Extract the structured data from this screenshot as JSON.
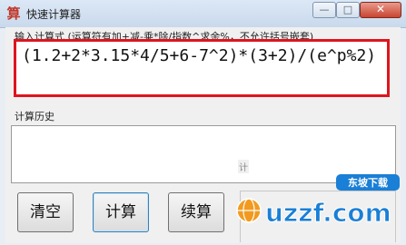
{
  "window": {
    "title": "快速计算器",
    "app_icon_glyph": "算",
    "minimize_glyph": "—",
    "maximize_glyph": "□",
    "close_glyph": "✕"
  },
  "input": {
    "label": "输入计算式 (运算符有加+减-乘*除/指数^求余%，不允许括号嵌套)",
    "expression": "(1.2+2*3.15*4/5+6-7^2)*(3+2)/(e^p%2)"
  },
  "history": {
    "label": "计算历史"
  },
  "buttons": {
    "clear": "清空",
    "calculate": "计算",
    "more": "续算"
  },
  "group": {
    "label": "计"
  },
  "watermark": {
    "top_text": "东坡下载",
    "brand": "uzzf.com"
  },
  "colors": {
    "highlight_border": "#e0141e",
    "watermark_blue": "#1a7fd6",
    "watermark_orange": "#f29a1f"
  }
}
